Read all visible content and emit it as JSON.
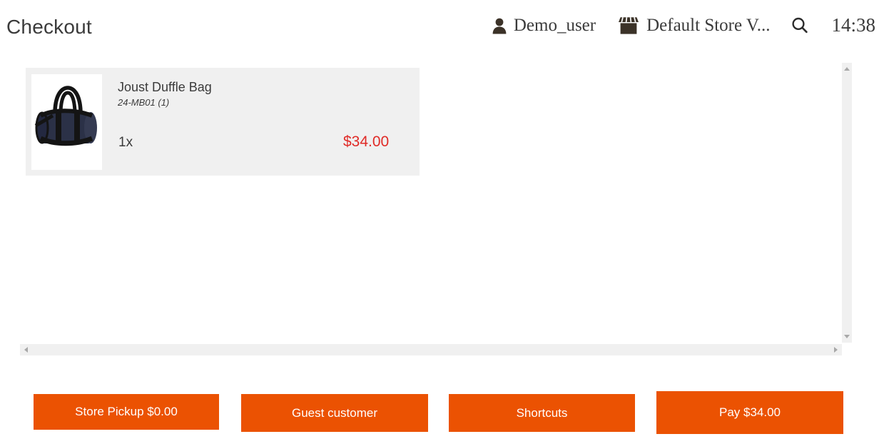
{
  "header": {
    "title": "Checkout",
    "user": {
      "icon": "person-icon",
      "label": "Demo_user"
    },
    "store": {
      "icon": "storefront-icon",
      "label": "Default Store V..."
    },
    "search": {
      "icon": "search-icon"
    },
    "time": "14:38"
  },
  "cart": {
    "items": [
      {
        "name": "Joust Duffle Bag",
        "sku": "24-MB01 (1)",
        "qty": "1x",
        "price": "$34.00",
        "thumbnail": "duffle-bag-image"
      }
    ]
  },
  "scrollbars": {
    "vertical": {
      "up": "scroll-up-arrow",
      "down": "scroll-down-arrow"
    },
    "horizontal": {
      "left": "scroll-left-arrow",
      "right": "scroll-right-arrow"
    }
  },
  "footer": {
    "buttons": [
      {
        "label": "Store Pickup $0.00"
      },
      {
        "label": "Guest customer"
      },
      {
        "label": "Shortcuts"
      },
      {
        "label": "Pay $34.00"
      }
    ]
  },
  "colors": {
    "accent": "#eb5202",
    "price": "#e02b27",
    "card_bg": "#f0f0f0",
    "text": "#3b3b3b"
  }
}
